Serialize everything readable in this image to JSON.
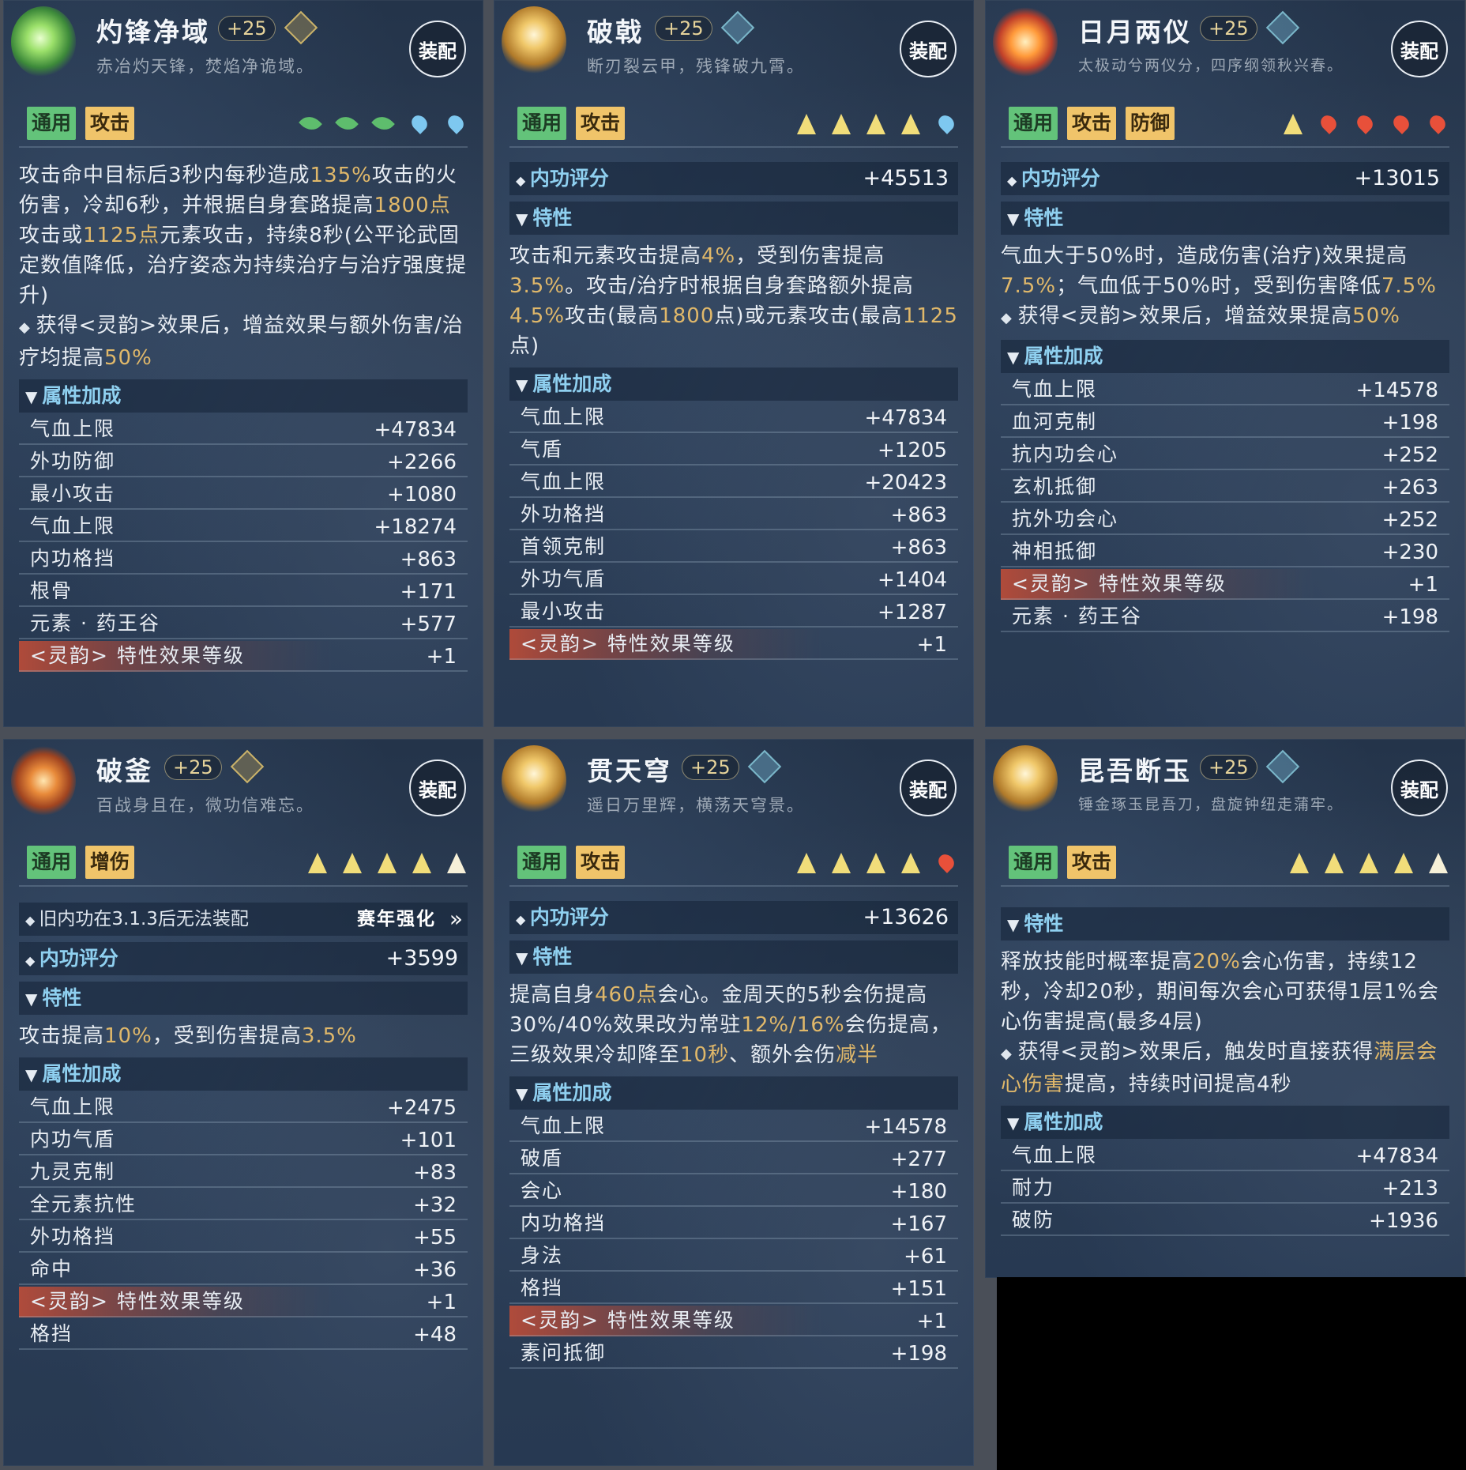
{
  "equip_label": "装配",
  "cards": [
    {
      "name": "灼锋净域",
      "level": "+25",
      "quote": "赤冶灼天锋，焚焰净诡域。",
      "tags": [
        "通用",
        "攻击"
      ],
      "desc_parts": {
        "a": "攻击命中目标后3秒内每秒造成",
        "b": "135%",
        "c": "攻击的火伤害，冷却6秒，并根据自身套路提高",
        "d": "1800点",
        "e": "攻击或",
        "f": "1125点",
        "g": "元素攻击，持续8秒(公平论武固定数值降低，治疗姿态为持续治疗与治疗强度提升)",
        "h": "获得<灵韵>效果后，增益效果与额外伤害/治疗均提高",
        "i": "50%"
      },
      "section": "属性加成",
      "rows": [
        {
          "label": "气血上限",
          "value": "+47834"
        },
        {
          "label": "外功防御",
          "value": "+2266"
        },
        {
          "label": "最小攻击",
          "value": "+1080"
        },
        {
          "label": "气血上限",
          "value": "+18274"
        },
        {
          "label": "内功格挡",
          "value": "+863"
        },
        {
          "label": "根骨",
          "value": "+171"
        },
        {
          "label": "元素 · 药王谷",
          "value": "+577"
        },
        {
          "label": "<灵韵> 特性效果等级",
          "value": "+1"
        }
      ]
    },
    {
      "name": "破戟",
      "level": "+25",
      "quote": "断刃裂云甲，残锋破九霄。",
      "tags": [
        "通用",
        "攻击"
      ],
      "score_label": "内功评分",
      "score": "+45513",
      "trait": "特性",
      "desc_parts": {
        "a": "攻击和元素攻击提高",
        "b": "4%",
        "c": "，受到伤害提高",
        "d": "3.5%",
        "e": "。攻击/治疗时根据自身套路额外提高",
        "f": "4.5%",
        "g": "攻击(最高",
        "h": "1800",
        "i": "点)或元素攻击(最高",
        "j": "1125",
        "k": "点)"
      },
      "section": "属性加成",
      "rows": [
        {
          "label": "气血上限",
          "value": "+47834"
        },
        {
          "label": "气盾",
          "value": "+1205"
        },
        {
          "label": "气血上限",
          "value": "+20423"
        },
        {
          "label": "外功格挡",
          "value": "+863"
        },
        {
          "label": "首领克制",
          "value": "+863"
        },
        {
          "label": "外功气盾",
          "value": "+1404"
        },
        {
          "label": "最小攻击",
          "value": "+1287"
        },
        {
          "label": "<灵韵> 特性效果等级",
          "value": "+1"
        }
      ]
    },
    {
      "name": "日月两仪",
      "level": "+25",
      "quote": "太极动兮两仪分，四序纲领秋兴春。",
      "tags": [
        "通用",
        "攻击",
        "防御"
      ],
      "score_label": "内功评分",
      "score": "+13015",
      "trait": "特性",
      "desc_parts": {
        "a": "气血大于50%时，造成伤害(治疗)效果提高",
        "b": "7.5%",
        "c": "；气血低于50%时，受到伤害降低",
        "d": "7.5%",
        "e": "获得<灵韵>效果后，增益效果提高",
        "f": "50%"
      },
      "section": "属性加成",
      "rows": [
        {
          "label": "气血上限",
          "value": "+14578"
        },
        {
          "label": "血河克制",
          "value": "+198"
        },
        {
          "label": "抗内功会心",
          "value": "+252"
        },
        {
          "label": "玄机抵御",
          "value": "+263"
        },
        {
          "label": "抗外功会心",
          "value": "+252"
        },
        {
          "label": "神相抵御",
          "value": "+230"
        },
        {
          "label": "<灵韵> 特性效果等级",
          "value": "+1"
        },
        {
          "label": "元素 · 药王谷",
          "value": "+198"
        }
      ]
    },
    {
      "name": "破釜",
      "level": "+25",
      "quote": "百战身且在，微功信难忘。",
      "tags": [
        "通用",
        "增伤"
      ],
      "old_note": "旧内功在3.1.3后无法装配",
      "enhance": "赛年强化",
      "score_label": "内功评分",
      "score": "+3599",
      "trait": "特性",
      "desc_parts": {
        "a": "攻击提高",
        "b": "10%",
        "c": "，受到伤害提高",
        "d": "3.5%"
      },
      "section": "属性加成",
      "rows": [
        {
          "label": "气血上限",
          "value": "+2475"
        },
        {
          "label": "内功气盾",
          "value": "+101"
        },
        {
          "label": "九灵克制",
          "value": "+83"
        },
        {
          "label": "全元素抗性",
          "value": "+32"
        },
        {
          "label": "外功格挡",
          "value": "+55"
        },
        {
          "label": "命中",
          "value": "+36"
        },
        {
          "label": "<灵韵> 特性效果等级",
          "value": "+1"
        },
        {
          "label": "格挡",
          "value": "+48"
        }
      ]
    },
    {
      "name": "贯天穹",
      "level": "+25",
      "quote": "遥日万里辉，横荡天穹景。",
      "tags": [
        "通用",
        "攻击"
      ],
      "score_label": "内功评分",
      "score": "+13626",
      "trait": "特性",
      "desc_parts": {
        "a": "提高自身",
        "b": "460点",
        "c": "会心。金周天的5秒会伤提高30%/40%效果改为常驻",
        "d": "12%/16%",
        "e": "会伤提高，三级效果冷却降至",
        "f": "10秒",
        "g": "、额外会伤",
        "h": "减半"
      },
      "section": "属性加成",
      "rows": [
        {
          "label": "气血上限",
          "value": "+14578"
        },
        {
          "label": "破盾",
          "value": "+277"
        },
        {
          "label": "会心",
          "value": "+180"
        },
        {
          "label": "内功格挡",
          "value": "+167"
        },
        {
          "label": "身法",
          "value": "+61"
        },
        {
          "label": "格挡",
          "value": "+151"
        },
        {
          "label": "<灵韵> 特性效果等级",
          "value": "+1"
        },
        {
          "label": "素问抵御",
          "value": "+198"
        }
      ]
    },
    {
      "name": "昆吾断玉",
      "level": "+25",
      "quote": "锤金琢玉昆吾刀，盘旋钟纽走蒲牢。",
      "tags": [
        "通用",
        "攻击"
      ],
      "trait": "特性",
      "desc_parts": {
        "a": "释放技能时概率提高",
        "b": "20%",
        "c": "会心伤害，持续12秒，冷却20秒，期间每次会心可获得1层1%会心伤害提高(最多4层)",
        "d": "获得<灵韵>效果后，触发时直接获得",
        "e": "满层会心伤害",
        "f": "提高，持续时间提高4秒"
      },
      "section": "属性加成",
      "rows": [
        {
          "label": "气血上限",
          "value": "+47834"
        },
        {
          "label": "耐力",
          "value": "+213"
        },
        {
          "label": "破防",
          "value": "+1936"
        }
      ]
    }
  ]
}
